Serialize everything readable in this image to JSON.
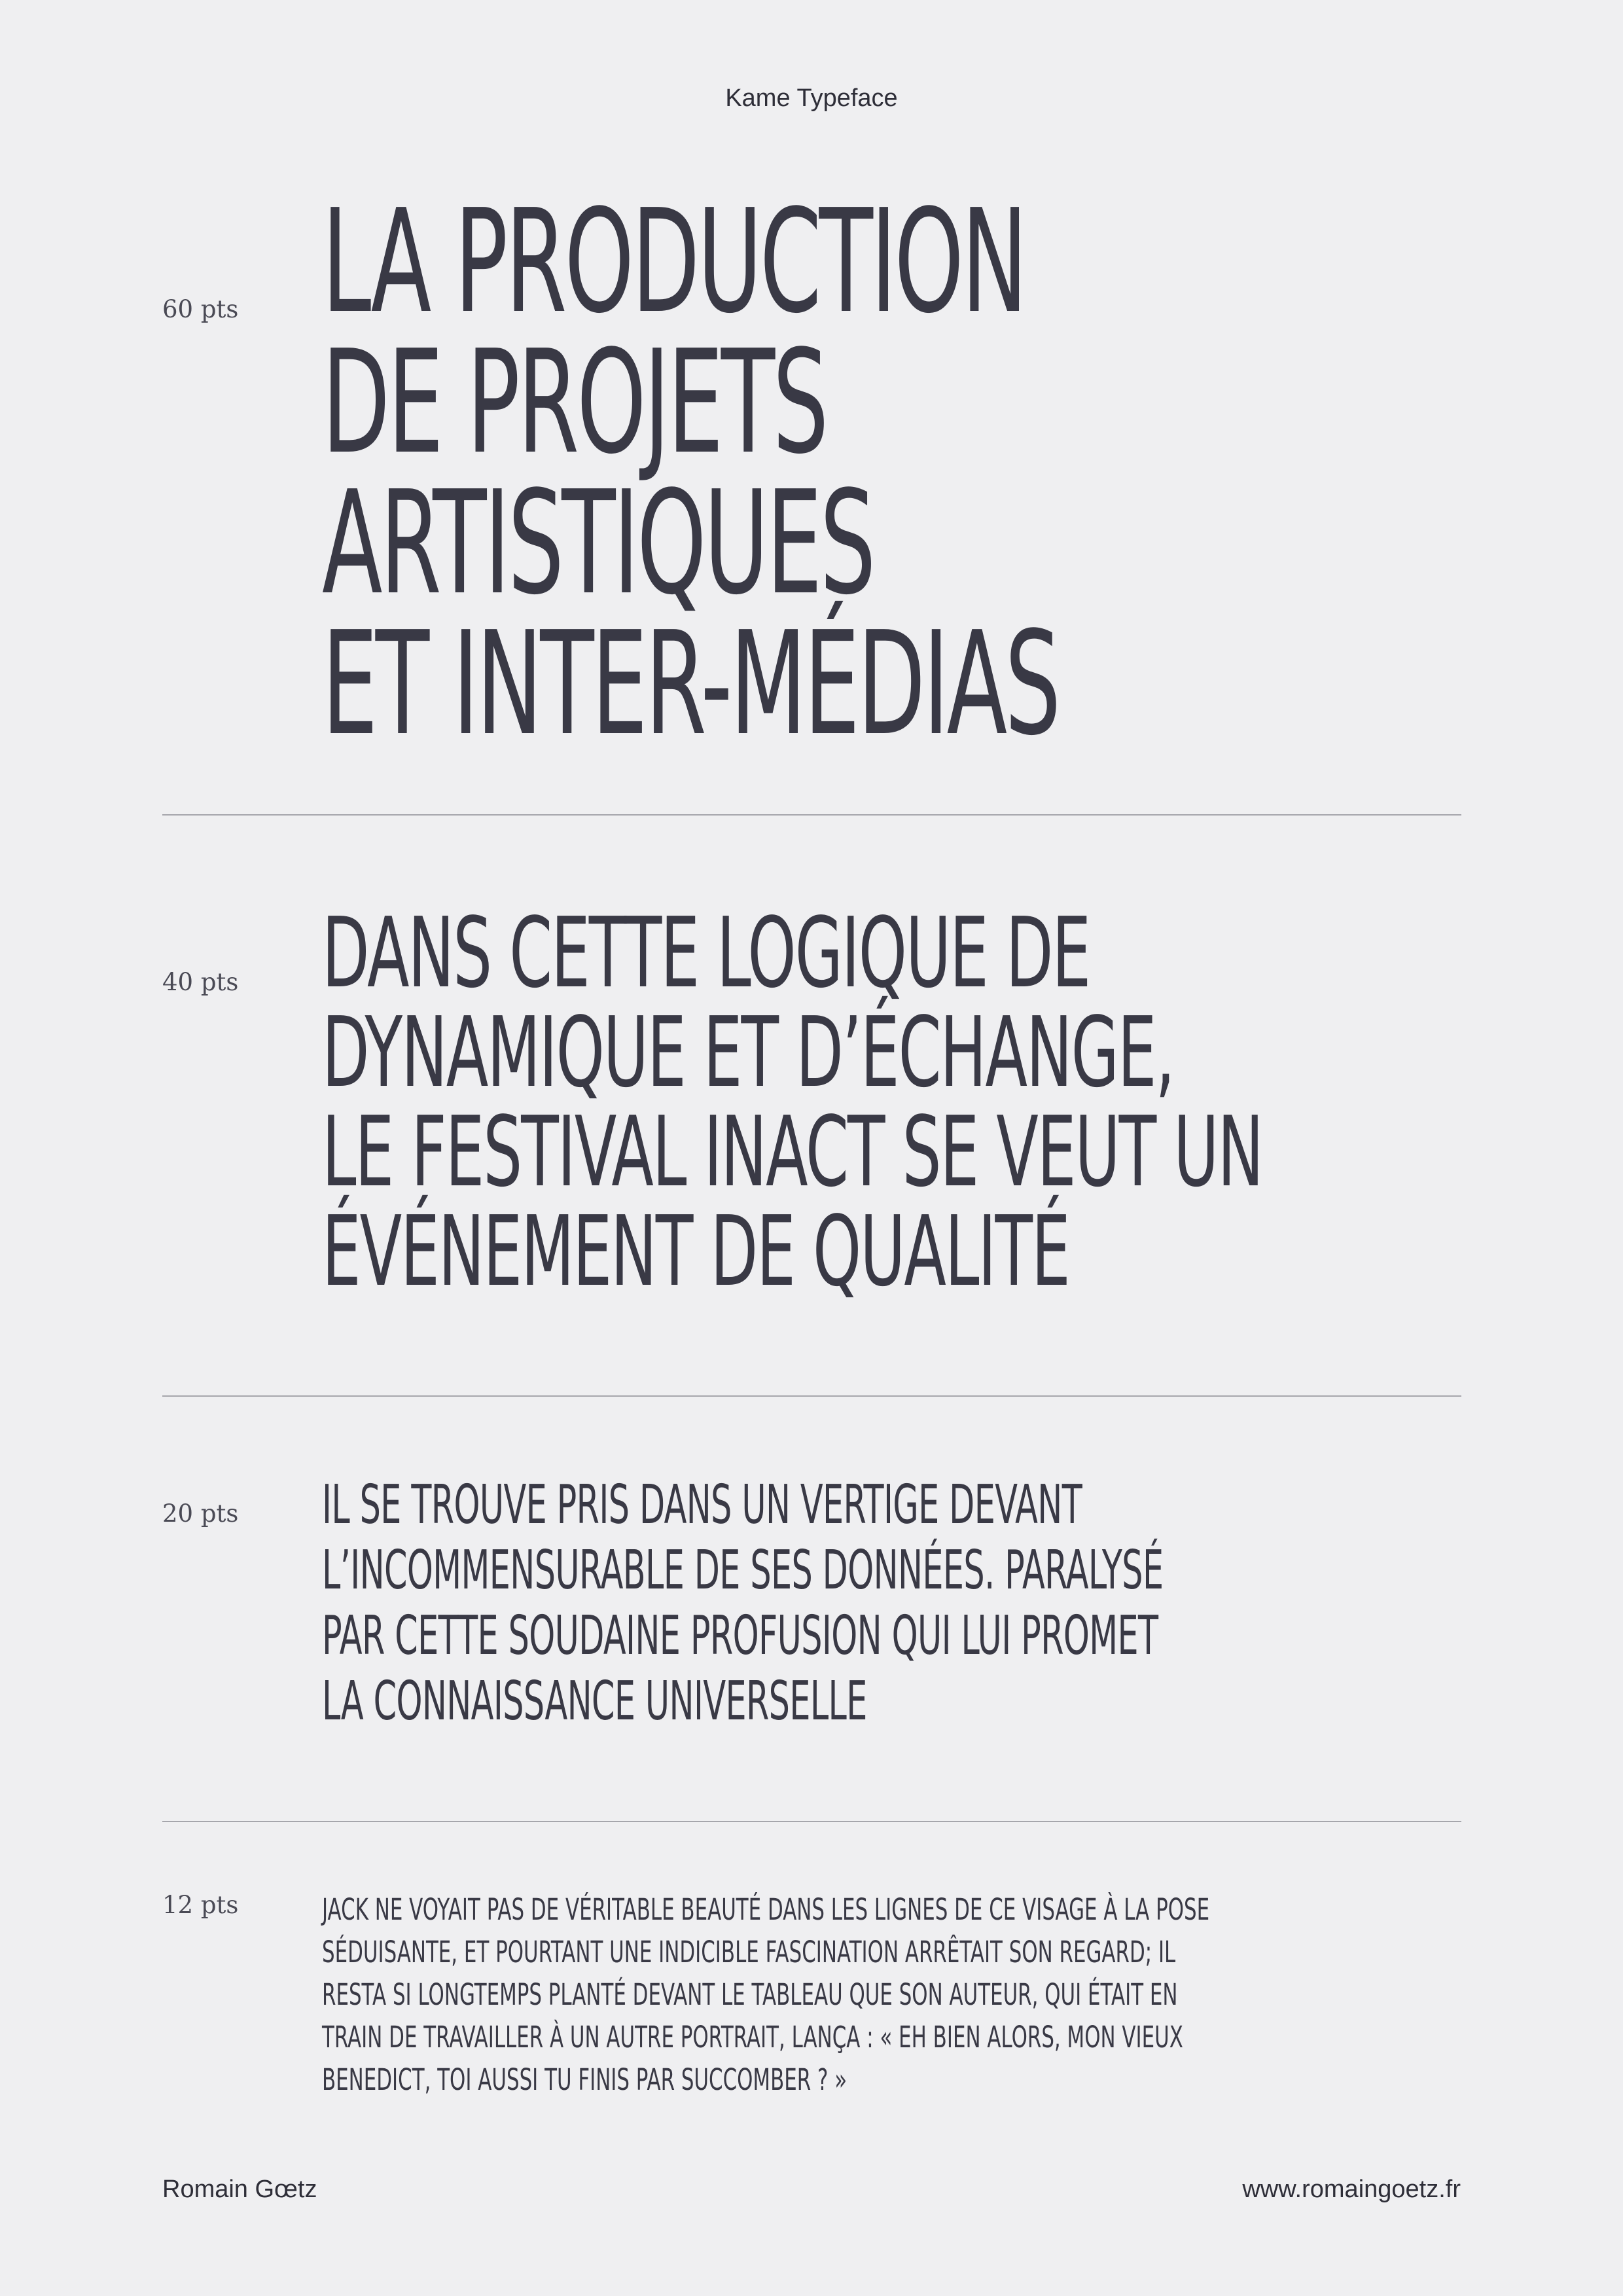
{
  "header": {
    "title": "Kame Typeface"
  },
  "specimens": [
    {
      "size_label": "60 pts",
      "lines": [
        "La production",
        "de projets",
        "artistiques",
        "et inter-médias"
      ]
    },
    {
      "size_label": "40 pts",
      "lines": [
        "Dans cette logique de",
        "dynamique et d’échange,",
        "le Festival INACT se veut un",
        "événement de qualité"
      ]
    },
    {
      "size_label": "20 pts",
      "lines": [
        "Il se trouve pris dans un vertige devant",
        "l’incommensurable de ses données. Paralysé",
        "par cette soudaine profusion qui lui promet",
        "la connaissance universelle"
      ]
    },
    {
      "size_label": "12 pts",
      "lines": [
        "Jack ne voyait pas de véritable beauté dans les lignes de ce visage à la pose",
        "séduisante, et pourtant une indicible fascination arrêtait son regard; il",
        "resta si longtemps planté devant le tableau que son auteur, qui était en",
        "train de travailler à un autre portrait, lança : « Eh bien alors, mon vieux",
        "Benedict, toi aussi tu finis par succomber ? »"
      ]
    }
  ],
  "footer": {
    "author": "Romain Gœtz",
    "website": "www.romaingoetz.fr"
  }
}
